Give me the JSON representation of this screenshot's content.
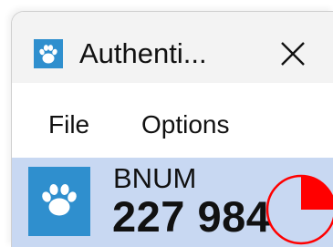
{
  "window": {
    "title": "Authenti...",
    "app_icon": "paw-icon",
    "close_icon": "close-icon"
  },
  "menu": {
    "items": [
      {
        "label": "File"
      },
      {
        "label": "Options"
      }
    ]
  },
  "account": {
    "name": "BNUM",
    "code": "227 984",
    "icon": "paw-icon",
    "timer_remaining_fraction": 0.25
  },
  "colors": {
    "accent_blue": "#2f8fce",
    "row_selected": "#c8d8f2",
    "timer_red": "#ff0000",
    "titlebar": "#f3f3f3"
  }
}
